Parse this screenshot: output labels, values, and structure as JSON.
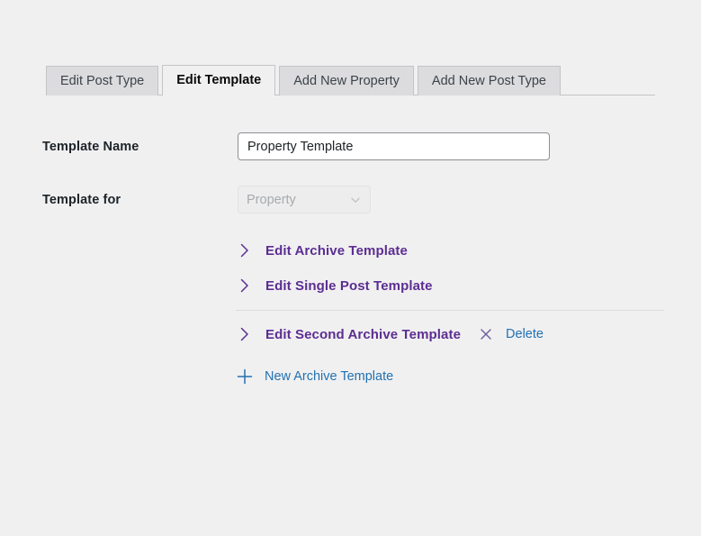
{
  "tabs": [
    {
      "label": "Edit Post Type",
      "active": false
    },
    {
      "label": "Edit Template",
      "active": true
    },
    {
      "label": "Add New Property",
      "active": false
    },
    {
      "label": "Add New Post Type",
      "active": false
    }
  ],
  "form": {
    "template_name": {
      "label": "Template Name",
      "value": "Property Template",
      "placeholder": "Template Name"
    },
    "template_for": {
      "label": "Template for",
      "value": "Property",
      "disabled": true,
      "options": [
        "Property"
      ]
    }
  },
  "template_rows": [
    {
      "label": "Edit Archive Template",
      "icon": "chevron-right-icon"
    },
    {
      "label": "Edit Single Post Template",
      "icon": "chevron-right-icon"
    },
    {
      "label": "Edit Second Archive Template",
      "icon": "chevron-right-icon",
      "delete_label": "Delete",
      "delete_icon": "close-x-icon"
    }
  ],
  "add_row": {
    "label": "New Archive Template",
    "icon": "plus-icon"
  },
  "colors": {
    "page_background": "#f0f0f1",
    "tab_inactive": "#dcdcde",
    "tab_border": "#c3c4c7",
    "link_purple": "#5c2e91",
    "link_blue": "#2271b1",
    "label_text": "#1d2327",
    "input_border": "#8c8f94",
    "disabled_text": "#a7aaad",
    "divider": "#dcdcde"
  }
}
